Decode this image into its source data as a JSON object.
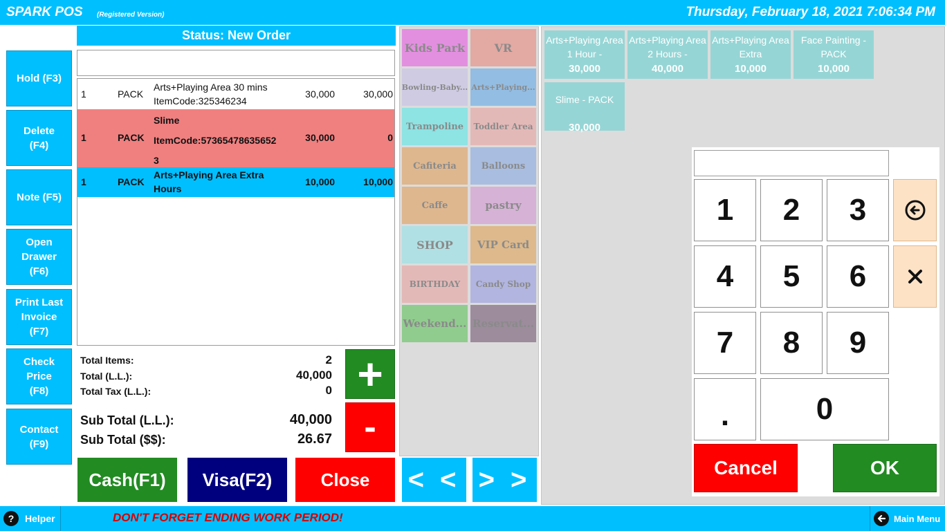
{
  "header": {
    "app_name": "SPARK POS",
    "edition": "(Registered Version)",
    "datetime": "Thursday, February 18, 2021 7:06:34 PM"
  },
  "functions": [
    {
      "label": "Hold (F3)"
    },
    {
      "label": "Delete\n(F4)"
    },
    {
      "label": "Note (F5)"
    },
    {
      "label": "Open\nDrawer\n(F6)"
    },
    {
      "label": "Print Last\nInvoice\n(F7)"
    },
    {
      "label": "Check\nPrice\n(F8)"
    },
    {
      "label": "Contact\n(F9)"
    }
  ],
  "order": {
    "status": "Status: New Order",
    "search_value": "",
    "rows": [
      {
        "qty": "1",
        "unit": "PACK",
        "desc": "Arts+Playing Area 30 mins\n ItemCode:325346234",
        "price": "30,000",
        "total": "30,000",
        "state": "normal"
      },
      {
        "qty": "1",
        "unit": "PACK",
        "desc": "Slime\nItemCode:57365478635652\n3",
        "price": "30,000",
        "total": "0",
        "state": "void"
      },
      {
        "qty": "1",
        "unit": "PACK",
        "desc": "Arts+Playing Area Extra\nHours",
        "price": "10,000",
        "total": "10,000",
        "state": "selected"
      }
    ]
  },
  "totals": {
    "items_label": "Total Items:",
    "items_value": "2",
    "total_label": "Total (L.L.):",
    "total_value": "40,000",
    "tax_label": "Total Tax (L.L.):",
    "tax_value": "0",
    "subtotal_ll_label": "Sub Total (L.L.):",
    "subtotal_ll_value": "40,000",
    "subtotal_usd_label": "Sub Total ($$):",
    "subtotal_usd_value": "26.67"
  },
  "qty_buttons": {
    "plus": "+",
    "minus": "-"
  },
  "payment": {
    "cash": "Cash(F1)",
    "visa": "Visa(F2)",
    "close": "Close"
  },
  "colors": {
    "accent": "#00bfff",
    "green": "#228b22",
    "red": "#ff0000",
    "navy": "#00007f",
    "void_row": "#f08080"
  },
  "categories": [
    {
      "label": "Kids Park",
      "color": "#e38fe0"
    },
    {
      "label": "VR",
      "color": "#e3a9a3"
    },
    {
      "label": "Bowling-Baby...",
      "color": "#cfcbe3"
    },
    {
      "label": "Arts+Playing...",
      "color": "#93bde3"
    },
    {
      "label": "Trampoline",
      "color": "#8ee3e3"
    },
    {
      "label": "Toddler Area",
      "color": "#e3b9b8"
    },
    {
      "label": "Cafiteria",
      "color": "#deb78f"
    },
    {
      "label": "Balloons",
      "color": "#a8bde0"
    },
    {
      "label": "Caffe",
      "color": "#deb78f"
    },
    {
      "label": "pastry",
      "color": "#d6b2d6"
    },
    {
      "label": "SHOP",
      "color": "#b0e0e3"
    },
    {
      "label": "VIP Card",
      "color": "#deb98b"
    },
    {
      "label": "BIRTHDAY",
      "color": "#e3b9b8"
    },
    {
      "label": "Candy Shop",
      "color": "#b1b5e0"
    },
    {
      "label": "Weekend...",
      "color": "#90cc8e"
    },
    {
      "label": "Reservat...",
      "color": "#9c8c9c"
    }
  ],
  "nav": {
    "prev": "< <",
    "next": "> >"
  },
  "items": [
    {
      "name": "Arts+Playing Area 1 Hour -",
      "price": "30,000"
    },
    {
      "name": "Arts+Playing Area 2 Hours -",
      "price": "40,000"
    },
    {
      "name": "Arts+Playing Area Extra",
      "price": "10,000"
    },
    {
      "name": "Face Painting - PACK",
      "price": "10,000"
    },
    {
      "name": "Slime - PACK",
      "price": "30,000"
    }
  ],
  "numpad": {
    "display_value": "",
    "keys": [
      "1",
      "2",
      "3",
      "4",
      "5",
      "6",
      "7",
      "8",
      "9",
      ".",
      "0"
    ],
    "backspace_icon": "arrow-left-circle-icon",
    "clear_icon": "x-icon",
    "cancel": "Cancel",
    "ok": "OK"
  },
  "footer": {
    "helper": "Helper",
    "helper_icon": "question-icon",
    "warning": "DON'T FORGET ENDING WORK PERIOD!",
    "main_menu": "Main Menu",
    "main_menu_icon": "arrow-left-icon"
  }
}
